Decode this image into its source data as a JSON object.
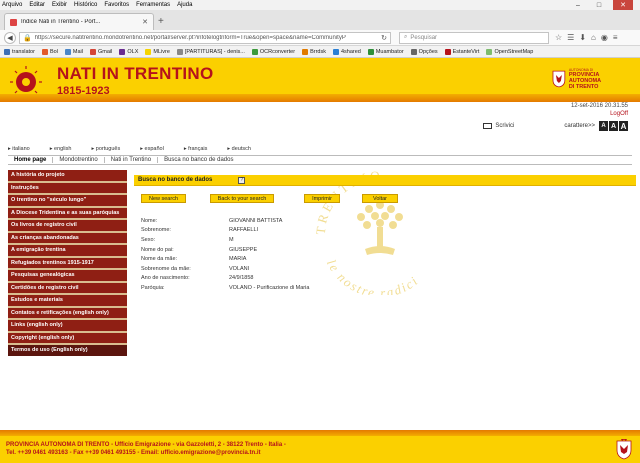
{
  "browser": {
    "menu": [
      "Arquivo",
      "Editar",
      "Exibir",
      "Histórico",
      "Favoritos",
      "Ferramentas",
      "Ajuda"
    ],
    "tab_title": "Indice Nati in Trentino - Port...",
    "url": "https://secure.natitrentino.mondotrentino.net/portal/server.pt?infotelogtnform=True&open=space&name=CommunityP",
    "search_placeholder": "Pesquisar",
    "bookmarks": [
      {
        "label": "translator",
        "color": "#3d6fb6"
      },
      {
        "label": "Bol",
        "color": "#e25a2b"
      },
      {
        "label": "Mail",
        "color": "#4a86c8"
      },
      {
        "label": "Gmail",
        "color": "#d44638"
      },
      {
        "label": "OLX",
        "color": "#6a2c91"
      },
      {
        "label": "MLivre",
        "color": "#f5d400"
      },
      {
        "label": "[PARTITURAS] - denis...",
        "color": "#888888"
      },
      {
        "label": "OCRconverter",
        "color": "#3c9a3c"
      },
      {
        "label": "Brrdsk",
        "color": "#e07b00"
      },
      {
        "label": "4shared",
        "color": "#2a7fd4"
      },
      {
        "label": "Muambator",
        "color": "#2f8f3a"
      },
      {
        "label": "Opções",
        "color": "#666666"
      },
      {
        "label": "EstanteVirt",
        "color": "#b5121b"
      },
      {
        "label": "OpenStreetMap",
        "color": "#7ebc6f"
      }
    ]
  },
  "header": {
    "title": "NATI IN TRENTINO",
    "years": "1815-1923",
    "logo_text": "TRENTINO",
    "prov_small": "AUTONOMA DI",
    "prov_big1": "PROVINCIA AUTONOMA",
    "prov_big2": "DI TRENTO"
  },
  "top": {
    "date": "12-set-2016 20.31.55",
    "logoff": "LogOff",
    "scrivici": "Scrivici",
    "char_label": "carattere>>",
    "sizes": [
      "A",
      "A",
      "A"
    ]
  },
  "languages": [
    "italiano",
    "english",
    "português",
    "español",
    "français",
    "deutsch"
  ],
  "breadcrumb": [
    "Home page",
    "Mondotrentino",
    "Nati in Trentino",
    "Busca no banco de dados"
  ],
  "sidebar": [
    "A história do projeto",
    "Instruções",
    "O trentino no \"século lungo\"",
    "A Diocese Tridentina e as suas paróquias",
    "Os livros de registro civil",
    "As crianças abandonadas",
    "A emigração trentina",
    "Refugiados trentinos 1915-1917",
    "Pesquisas genealógicas",
    "Certidões de registro civil",
    "Estudos e materiais",
    "Contatos e retificações (english only)",
    "Links (english only)",
    "Copyright (english only)",
    "Termos de uso (English only)"
  ],
  "panel": {
    "title": "Busca no banco de dados",
    "help": "?",
    "buttons": [
      "New search",
      "Back to your search",
      "Imprimir",
      "Voltar"
    ],
    "watermark": "le nostre radici"
  },
  "record": [
    {
      "label": "Nome:",
      "value": "GIOVANNI BATTISTA"
    },
    {
      "label": "Sobrenome:",
      "value": "RAFFAELLI"
    },
    {
      "label": "Sexo:",
      "value": "M"
    },
    {
      "label": "Nome do pai:",
      "value": "GIUSEPPE"
    },
    {
      "label": "Nome da mãe:",
      "value": "MARIA"
    },
    {
      "label": "Sobrenome da mãe:",
      "value": "VOLANI"
    },
    {
      "label": "Ano de nascimento:",
      "value": "24/9/1858"
    },
    {
      "label": "Paróquia:",
      "value": "VOLANO - Purificazione di Maria"
    }
  ],
  "footer": {
    "line1": "PROVINCIA AUTONOMA DI TRENTO - Ufficio Emigrazione - via Gazzoletti, 2 - 38122 Trento - Italia -",
    "line2": "Tel. ++39 0461 493163 - Fax ++39 0461 493155 - Email: ufficio.emigrazione@provincia.tn.it"
  },
  "colors": {
    "brand_red": "#b5121b",
    "brand_yellow": "#fbd000",
    "sidebar": "#8f1f14"
  }
}
